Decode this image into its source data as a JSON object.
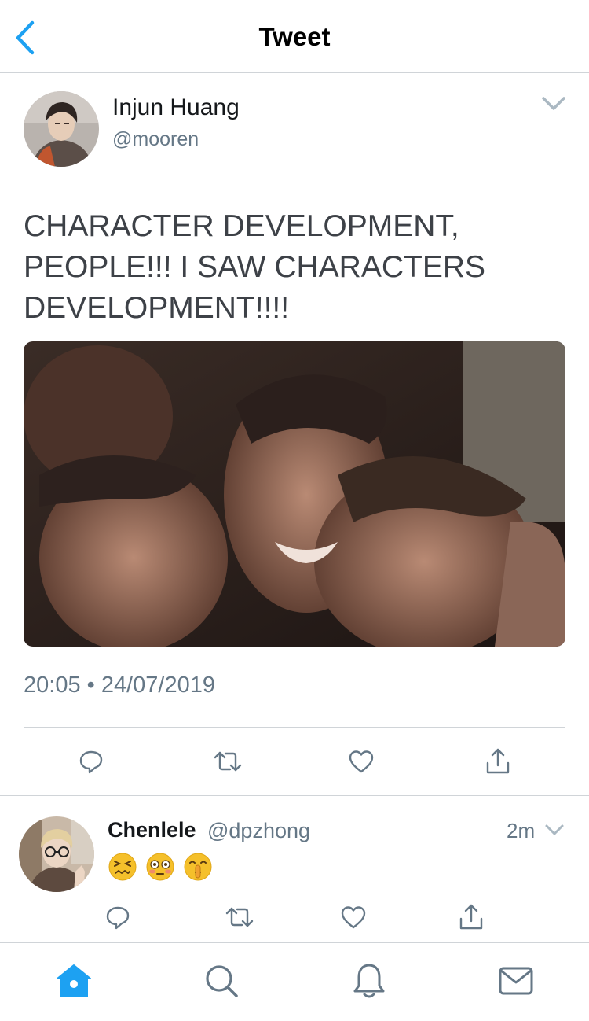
{
  "header": {
    "title": "Tweet",
    "back_icon": "chevron-left-icon"
  },
  "colors": {
    "accent": "#1da1f2",
    "secondary_text": "#657786",
    "divider": "#d0d4d8",
    "tweet_text": "#3d4147"
  },
  "tweet": {
    "author_name": "Injun Huang",
    "author_handle": "@mooren",
    "text": "CHARACTER DEVELOPMENT, PEOPLE!!! I SAW CHARACTERS DEVELOPMENT!!!!",
    "timestamp": "20:05 • 24/07/2019",
    "actions": [
      "reply-icon",
      "retweet-icon",
      "like-icon",
      "share-icon"
    ]
  },
  "reply": {
    "author_name": "Chenlele",
    "author_handle": "@dpzhong",
    "time": "2m",
    "emojis": [
      "confounded-face-icon",
      "flushed-face-icon",
      "shushing-face-icon"
    ],
    "actions": [
      "reply-icon",
      "retweet-icon",
      "like-icon",
      "share-icon"
    ]
  },
  "tabbar": {
    "tabs": [
      "home-icon",
      "search-icon",
      "notifications-icon",
      "messages-icon"
    ],
    "active": "home-icon"
  }
}
